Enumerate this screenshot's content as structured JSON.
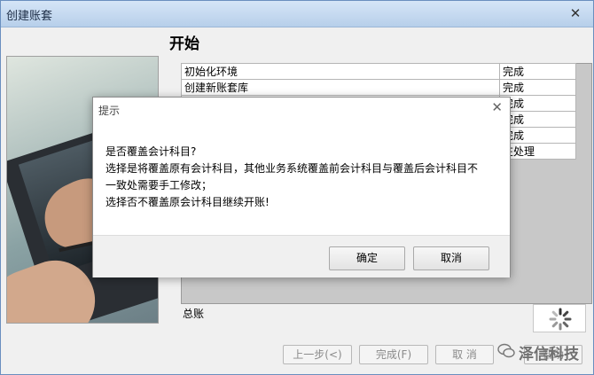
{
  "window": {
    "title": "创建账套",
    "close_glyph": "✕"
  },
  "step_title": "开始",
  "tasks": [
    {
      "name": "初始化环境",
      "status": "完成"
    },
    {
      "name": "创建新账套库",
      "status": "完成"
    },
    {
      "name": "",
      "status": "完成"
    },
    {
      "name": "",
      "status": "完成"
    },
    {
      "name": "",
      "status": "完成"
    },
    {
      "name": "",
      "status": "在处理"
    }
  ],
  "bottom_label": "总账",
  "footer": {
    "prev": "上一步(<)",
    "finish": "完成(F)",
    "cancel": "取 消",
    "help": "帮助"
  },
  "dialog": {
    "title": "提示",
    "close_glyph": "✕",
    "lines": [
      "是否覆盖会计科目?",
      "选择是将覆盖原有会计科目，其他业务系统覆盖前会计科目与覆盖后会计科目不",
      "一致处需要手工修改；",
      "选择否不覆盖原会计科目继续开账!"
    ],
    "ok": "确定",
    "cancel": "取消"
  },
  "watermark": {
    "text": "泽信科技"
  },
  "icons": {
    "spinner": "loading-spinner-icon",
    "watermark": "wechat-icon"
  }
}
